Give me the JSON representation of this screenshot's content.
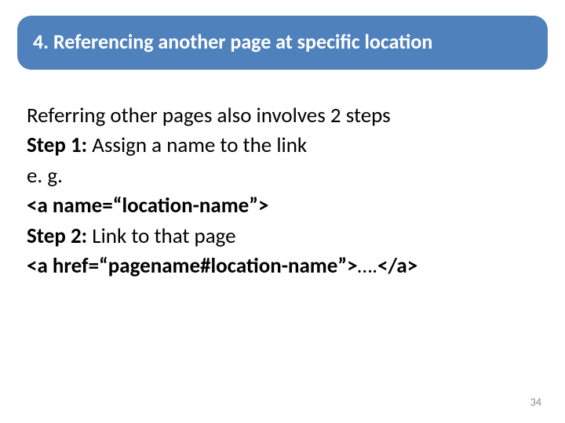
{
  "slide": {
    "title": "4. Referencing another page at specific location",
    "intro": "Referring other pages also involves 2 steps",
    "step1_label": "Step 1:",
    "step1_text": " Assign a name to the link",
    "eg": "e. g.",
    "code1": "<a name=“location-name”>",
    "step2_label": "Step 2:",
    "step2_text": " Link to that page",
    "code2_pre": " <a href=“pagename#location-name”>",
    "code2_mid": "….",
    "code2_post": "</a>",
    "page_number": "34"
  }
}
